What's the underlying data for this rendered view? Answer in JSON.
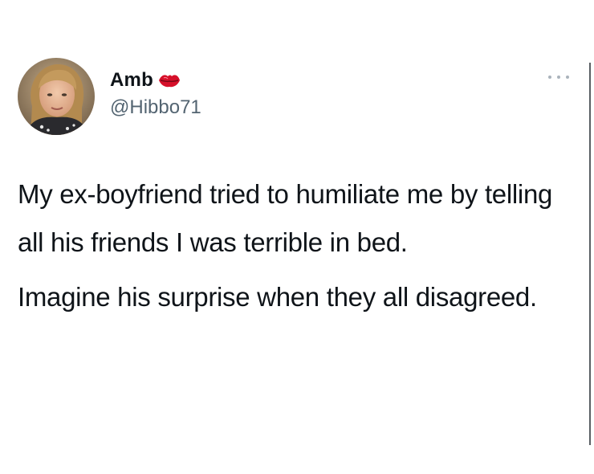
{
  "tweet": {
    "display_name": "Amb",
    "name_emoji_icon": "kiss-lips-icon",
    "handle": "@Hibbo71",
    "more_icon": "more-options-icon",
    "paragraphs": [
      "My ex-boyfriend tried to humiliate me by telling all his friends I was terrible in bed.",
      "Imagine his surprise when they all disagreed."
    ]
  },
  "colors": {
    "text": "#0f1419",
    "handle": "#536471",
    "kiss": "#d6102a"
  }
}
